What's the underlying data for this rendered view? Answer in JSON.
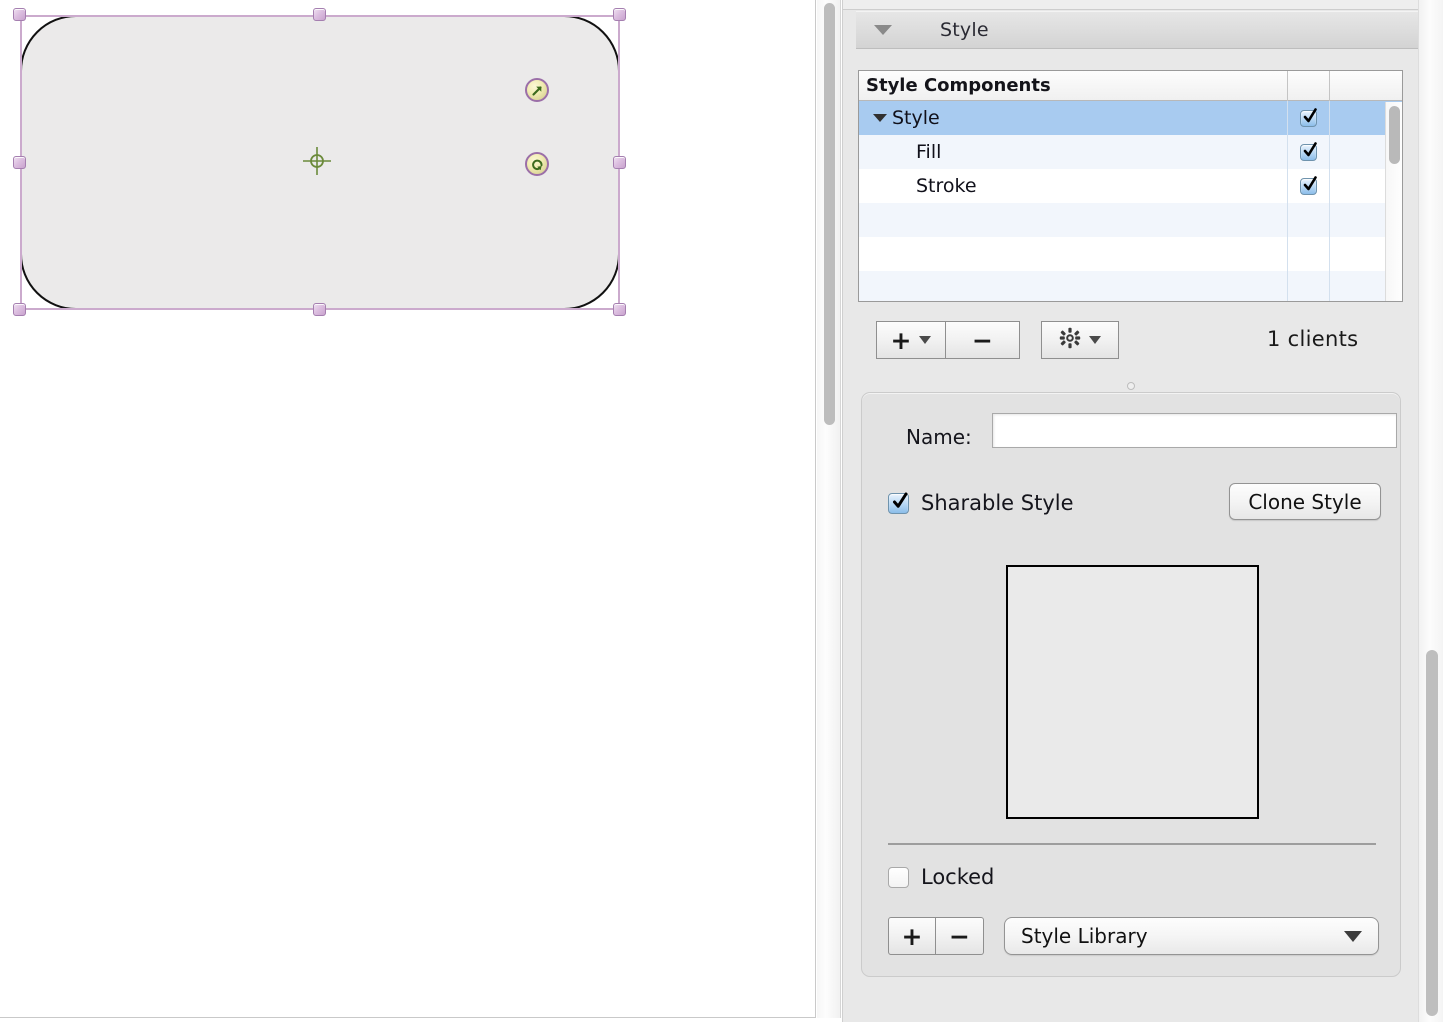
{
  "app": {
    "canvas": {
      "shape": {
        "name": "rounded-rectangle",
        "fill_color": "#ebeaea",
        "stroke_color": "#000000",
        "selection_color": "#cbaacd"
      },
      "badges": [
        {
          "name": "resize-arrow-badge",
          "glyph": "↗"
        },
        {
          "name": "rotate-badge",
          "glyph": "↻"
        }
      ]
    },
    "inspector": {
      "section": {
        "title": "Style",
        "expanded": true
      },
      "style_components": {
        "column_header": "Style Components",
        "rows": [
          {
            "label": "Style",
            "indent": 0,
            "has_disclosure": true,
            "checked": true,
            "selected": true
          },
          {
            "label": "Fill",
            "indent": 1,
            "has_disclosure": false,
            "checked": true,
            "selected": false
          },
          {
            "label": "Stroke",
            "indent": 1,
            "has_disclosure": false,
            "checked": true,
            "selected": false
          }
        ],
        "empty_row_count": 4
      },
      "toolbar": {
        "add_label": "+",
        "remove_label": "−",
        "action_label": "gear-icon",
        "clients_count": "1  clients"
      },
      "detail": {
        "name_label": "Name:",
        "name_value": "",
        "name_placeholder": "",
        "sharable_style_label": "Sharable Style",
        "sharable_style_checked": true,
        "clone_style_label": "Clone Style",
        "preview_fill": "#eaeaea",
        "preview_stroke": "#000000",
        "locked_label": "Locked",
        "locked_checked": false,
        "library_add_label": "+",
        "library_remove_label": "−",
        "library_select_value": "Style Library"
      }
    }
  }
}
